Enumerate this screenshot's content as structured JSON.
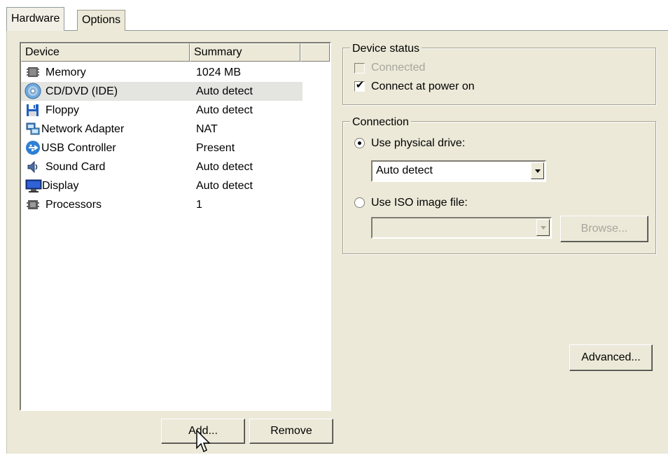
{
  "tabs": [
    {
      "label": "Hardware",
      "active": true
    },
    {
      "label": "Options",
      "active": false
    }
  ],
  "device_list": {
    "columns": [
      "Device",
      "Summary"
    ],
    "rows": [
      {
        "icon": "memory-icon",
        "device": "Memory",
        "summary": "1024 MB",
        "selected": false
      },
      {
        "icon": "cd-dvd-icon",
        "device": "CD/DVD (IDE)",
        "summary": "Auto detect",
        "selected": true
      },
      {
        "icon": "floppy-icon",
        "device": "Floppy",
        "summary": "Auto detect",
        "selected": false
      },
      {
        "icon": "network-adapter-icon",
        "device": "Network Adapter",
        "summary": "NAT",
        "selected": false
      },
      {
        "icon": "usb-icon",
        "device": "USB Controller",
        "summary": "Present",
        "selected": false
      },
      {
        "icon": "sound-card-icon",
        "device": "Sound Card",
        "summary": "Auto detect",
        "selected": false
      },
      {
        "icon": "display-icon",
        "device": "Display",
        "summary": "Auto detect",
        "selected": false
      },
      {
        "icon": "processor-icon",
        "device": "Processors",
        "summary": "1",
        "selected": false
      }
    ]
  },
  "buttons": {
    "add": "Add...",
    "remove": "Remove",
    "browse": "Browse...",
    "advanced": "Advanced..."
  },
  "device_status": {
    "title": "Device status",
    "connected_label": "Connected",
    "connected_checked": false,
    "connected_disabled": true,
    "power_on_label": "Connect at power on",
    "power_on_checked": true
  },
  "connection": {
    "title": "Connection",
    "physical_label": "Use physical drive:",
    "physical_selected": true,
    "physical_value": "Auto detect",
    "iso_label": "Use ISO image file:",
    "iso_selected": false,
    "iso_value": ""
  },
  "colors": {
    "panel": "#ece9d8",
    "selection": "#e4e4e0",
    "disabled_text": "#a8a69c"
  }
}
